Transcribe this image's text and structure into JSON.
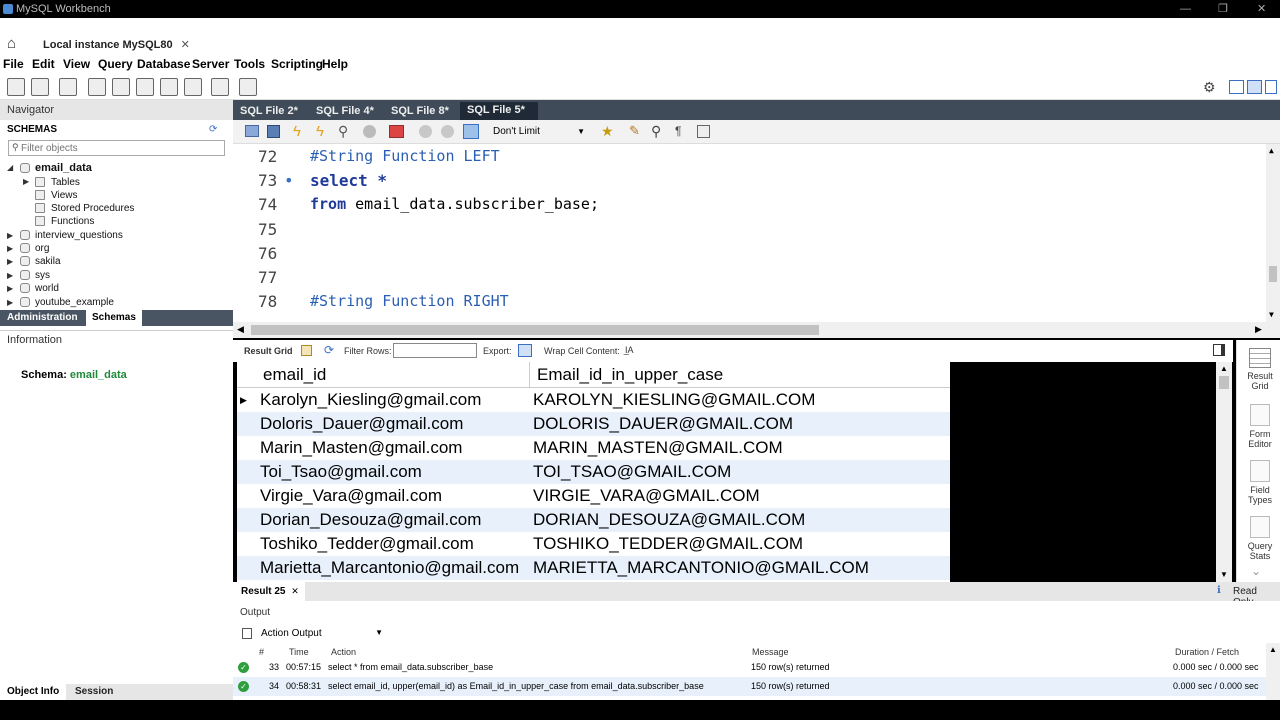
{
  "window": {
    "title": "MySQL Workbench",
    "connection_tab": "Local instance MySQL80"
  },
  "menu": [
    "File",
    "Edit",
    "View",
    "Query",
    "Database",
    "Server",
    "Tools",
    "Scripting",
    "Help"
  ],
  "navigator": {
    "title": "Navigator",
    "schemas_label": "SCHEMAS",
    "filter_placeholder": "Filter objects",
    "schemas": [
      {
        "name": "email_data",
        "expanded": true,
        "children": [
          "Tables",
          "Views",
          "Stored Procedures",
          "Functions"
        ]
      },
      {
        "name": "interview_questions"
      },
      {
        "name": "org"
      },
      {
        "name": "sakila"
      },
      {
        "name": "sys"
      },
      {
        "name": "world"
      },
      {
        "name": "youtube_example"
      }
    ],
    "tabs": [
      "Administration",
      "Schemas"
    ],
    "info_header": "Information",
    "schema_info_label": "Schema:",
    "schema_info_value": "email_data",
    "bottom_tabs": [
      "Object Info",
      "Session"
    ]
  },
  "sql_tabs": [
    "SQL File 2*",
    "SQL File 4*",
    "SQL File 8*",
    "SQL File 5*"
  ],
  "active_sql_tab": "SQL File 5*",
  "limit_select": "Don't Limit",
  "editor": {
    "lines": [
      {
        "num": "72",
        "text": "#String Function LEFT",
        "type": "comment"
      },
      {
        "num": "73",
        "text": "select *",
        "type": "keyword",
        "dot": "•"
      },
      {
        "num": "74",
        "kw": "from",
        "text": "email_data.subscriber_base;",
        "type": "mixed"
      },
      {
        "num": "75",
        "text": ""
      },
      {
        "num": "76",
        "text": ""
      },
      {
        "num": "77",
        "text": ""
      },
      {
        "num": "78",
        "text": "#String Function RIGHT",
        "type": "comment"
      }
    ]
  },
  "resultbar": {
    "result_grid": "Result Grid",
    "filter_rows": "Filter Rows:",
    "export": "Export:",
    "wrap": "Wrap Cell Content:"
  },
  "grid": {
    "columns": [
      "email_id",
      "Email_id_in_upper_case"
    ],
    "rows": [
      [
        "Karolyn_Kiesling@gmail.com",
        "KAROLYN_KIESLING@GMAIL.COM"
      ],
      [
        "Doloris_Dauer@gmail.com",
        "DOLORIS_DAUER@GMAIL.COM"
      ],
      [
        "Marin_Masten@gmail.com",
        "MARIN_MASTEN@GMAIL.COM"
      ],
      [
        "Toi_Tsao@gmail.com",
        "TOI_TSAO@GMAIL.COM"
      ],
      [
        "Virgie_Vara@gmail.com",
        "VIRGIE_VARA@GMAIL.COM"
      ],
      [
        "Dorian_Desouza@gmail.com",
        "DORIAN_DESOUZA@GMAIL.COM"
      ],
      [
        "Toshiko_Tedder@gmail.com",
        "TOSHIKO_TEDDER@GMAIL.COM"
      ],
      [
        "Marietta_Marcantonio@gmail.com",
        "MARIETTA_MARCANTONIO@GMAIL.COM"
      ]
    ]
  },
  "side_panel": [
    {
      "label": "Result Grid"
    },
    {
      "label": "Form Editor"
    },
    {
      "label": "Field Types"
    },
    {
      "label": "Query Stats"
    }
  ],
  "result_tab": "Result 25",
  "read_only": "Read Only",
  "output": {
    "title": "Output",
    "mode": "Action Output",
    "headers": {
      "num": "#",
      "time": "Time",
      "action": "Action",
      "message": "Message",
      "duration": "Duration / Fetch"
    },
    "rows": [
      {
        "num": "33",
        "time": "00:57:15",
        "action": "select * from email_data.subscriber_base",
        "message": "150 row(s) returned",
        "duration": "0.000 sec / 0.000 sec"
      },
      {
        "num": "34",
        "time": "00:58:31",
        "action": "select email_id, upper(email_id) as Email_id_in_upper_case from email_data.subscriber_base",
        "message": "150 row(s) returned",
        "duration": "0.000 sec / 0.000 sec"
      }
    ]
  },
  "colors": {
    "tab_dark": "#3f4b59",
    "keyword": "#1f3b9a",
    "comment": "#2b5fb3",
    "ok": "#2e9e3e",
    "alt_row": "#e8f1fb"
  }
}
